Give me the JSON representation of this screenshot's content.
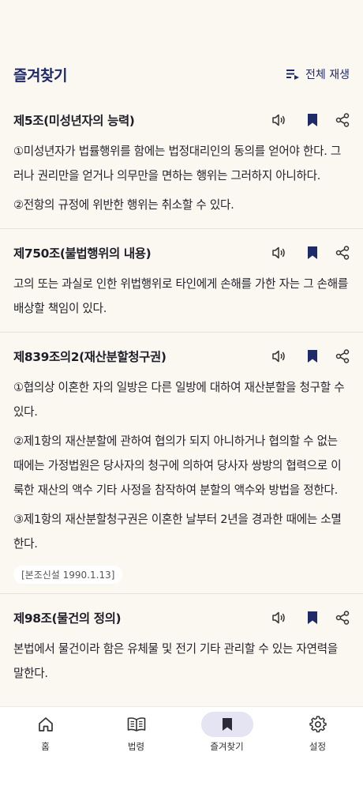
{
  "header": {
    "title": "즐겨찾기",
    "play_all_label": "전체 재생"
  },
  "articles": [
    {
      "title": "제5조(미성년자의 능력)",
      "paragraphs": [
        "①미성년자가 법률행위를 함에는 법정대리인의 동의를 얻어야 한다. 그러나 권리만을 얻거나 의무만을 면하는 행위는 그러하지 아니하다.",
        "②전항의 규정에 위반한 행위는 취소할 수 있다."
      ]
    },
    {
      "title": "제750조(불법행위의 내용)",
      "paragraphs": [
        "고의 또는 과실로 인한 위법행위로 타인에게 손해를 가한 자는 그 손해를 배상할 책임이 있다."
      ]
    },
    {
      "title": "제839조의2(재산분할청구권)",
      "paragraphs": [
        "①협의상 이혼한 자의 일방은 다른 일방에 대하여 재산분할을 청구할 수 있다.",
        "②제1항의 재산분할에 관하여 협의가 되지 아니하거나 협의할 수 없는 때에는 가정법원은 당사자의 청구에 의하여 당사자 쌍방의 협력으로 이룩한 재산의 액수 기타 사정을 참작하여 분할의 액수와 방법을 정한다.",
        "③제1항의 재산분할청구권은 이혼한 날부터 2년을 경과한 때에는 소멸한다."
      ],
      "tag": "[본조신설 1990.1.13]"
    },
    {
      "title": "제98조(물건의 정의)",
      "paragraphs": [
        "본법에서 물건이라 함은 유체물 및 전기 기타 관리할 수 있는 자연력을 말한다."
      ]
    }
  ],
  "icons": {
    "speaker": "speaker-icon",
    "bookmark": "bookmark-icon",
    "share": "share-icon"
  },
  "nav": {
    "home": "홈",
    "laws": "법령",
    "favorites": "즐겨찾기",
    "settings": "설정"
  },
  "colors": {
    "accent": "#1f2a6b",
    "background": "#fbf8f2",
    "active_pill": "#e4e4f3"
  }
}
